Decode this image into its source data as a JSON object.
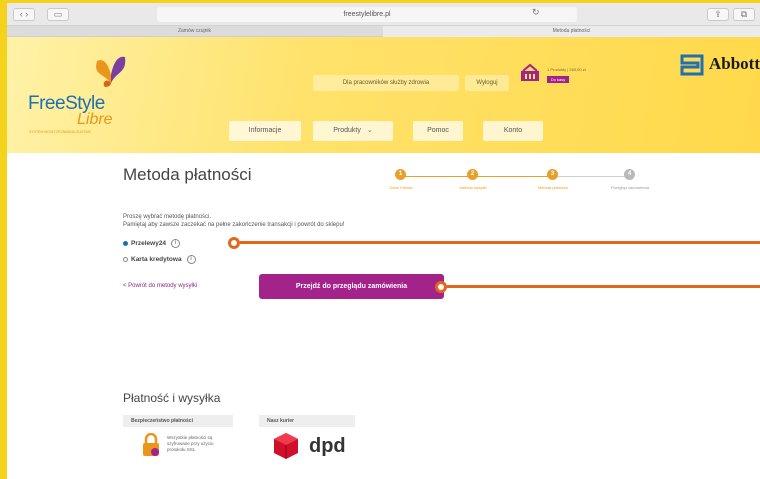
{
  "browser": {
    "url": "freestylelibre.pl",
    "tabs": [
      {
        "label": "Zamów czujnik",
        "active": false
      },
      {
        "label": "Metoda płatności",
        "active": true
      }
    ]
  },
  "header": {
    "logo_freestyle": "FreeStyle",
    "logo_libre": "Libre",
    "logo_tagline": "SYSTEM MONITOROWANIA GLIKEMII",
    "health_pros_label": "Dla pracowników służby zdrowia",
    "logout_label": "Wyloguj",
    "cart_summary": "1 Produkty | 269,00 zł",
    "cart_checkout_label": "Do kasy",
    "brand": "Abbott",
    "nav": [
      {
        "label": "Informacje"
      },
      {
        "label": "Produkty"
      },
      {
        "label": "Pomoc"
      },
      {
        "label": "Konto"
      }
    ]
  },
  "page": {
    "title": "Metoda płatności",
    "steps": [
      {
        "num": "1",
        "label": "Dane Klienta",
        "done": true
      },
      {
        "num": "2",
        "label": "Metoda wysyłki",
        "done": true
      },
      {
        "num": "3",
        "label": "Metoda płatności",
        "done": true
      },
      {
        "num": "4",
        "label": "Przegląd zamówienia",
        "done": false
      }
    ],
    "instruction_1": "Proszę wybrać metodę płatności.",
    "instruction_2": "Pamiętaj aby zawsze zaczekać na pełne zakończenie transakcji i powrót do sklepu!",
    "payment_options": [
      {
        "label": "Przelewy24",
        "checked": true
      },
      {
        "label": "Karta kredytowa",
        "checked": false
      }
    ],
    "back_link": "< Powrót do metody wysyłki",
    "cta_label": "Przejdź do przeglądu zamówienia"
  },
  "footer_info": {
    "section_title": "Płatność i wysyłka",
    "security_head": "Bezpieczeństwo płatności",
    "security_text": "Wszystkie płatności są szyfrowane przy użyciu protokołu SSL",
    "courier_head": "Nasz kurier",
    "courier_name": "dpd"
  },
  "colors": {
    "frame": "#f5d21c",
    "accent_purple": "#a3238b",
    "step_orange": "#e7a12b",
    "callout_orange": "#e4661c"
  }
}
